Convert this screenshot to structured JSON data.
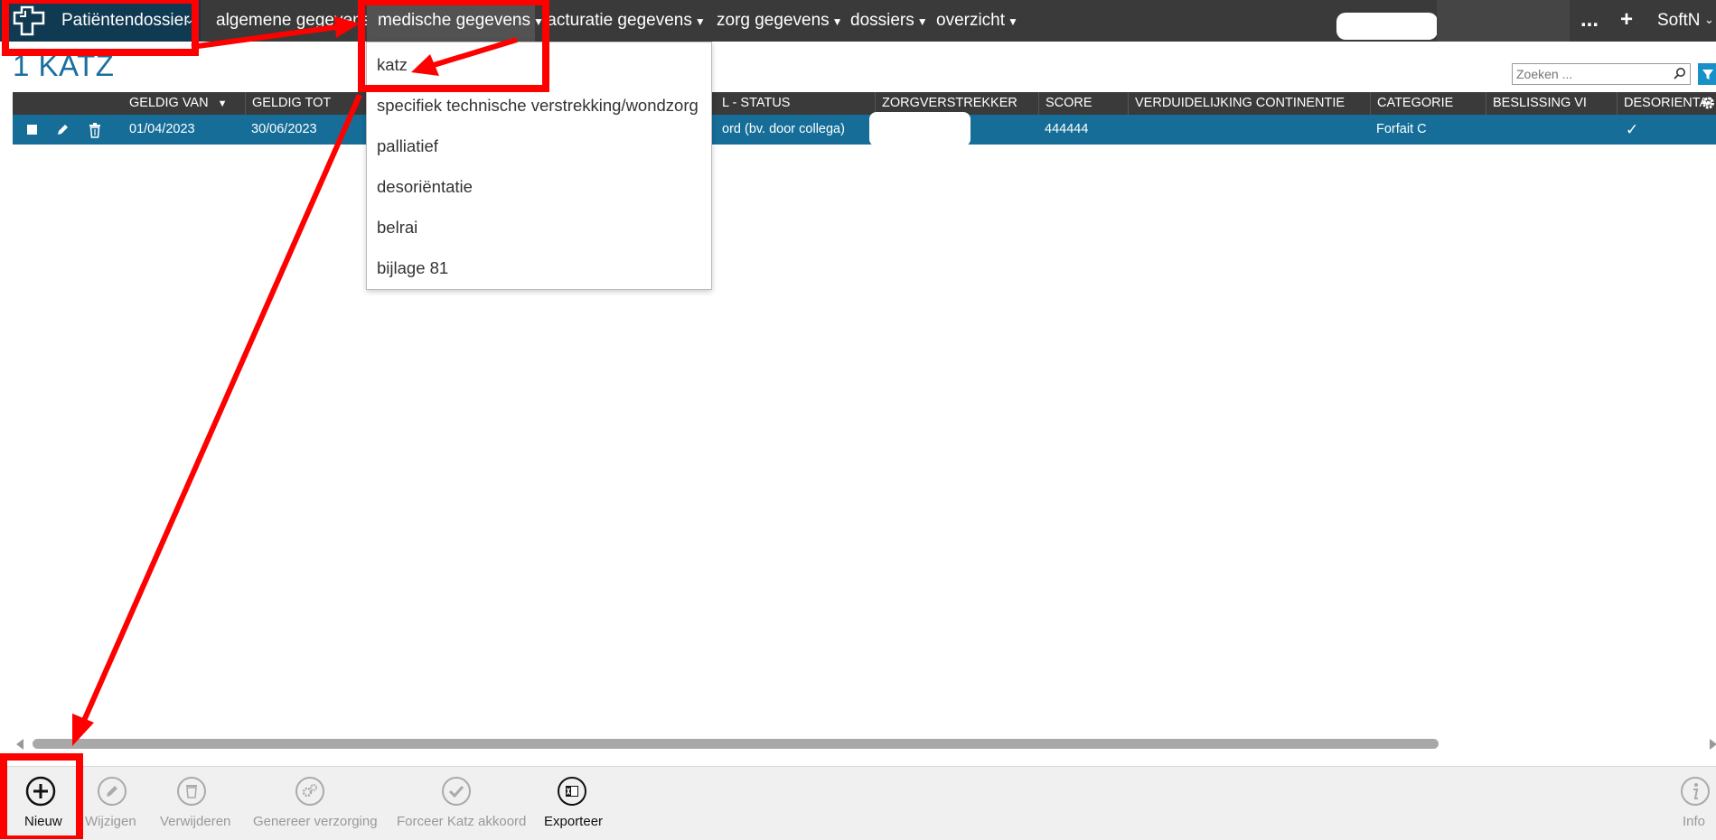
{
  "nav": {
    "brand": "Patiëntendossier",
    "items": [
      {
        "label": "algemene gegevens"
      },
      {
        "label": "medische gegevens"
      },
      {
        "label": "facturatie gegevens"
      },
      {
        "label": "zorg gegevens"
      },
      {
        "label": "dossiers"
      },
      {
        "label": "overzicht"
      }
    ],
    "more": "...",
    "add": "+",
    "user": "SoftN"
  },
  "page": {
    "title": "1 KATZ"
  },
  "search": {
    "placeholder": "Zoeken ..."
  },
  "grid": {
    "columns": [
      "GELDIG VAN",
      "GELDIG TOT",
      "",
      "",
      "L - STATUS",
      "ZORGVERSTREKKER",
      "SCORE",
      "VERDUIDELIJKING CONTINENTIE",
      "CATEGORIE",
      "BESLISSING VI",
      "DESORIENTATIE"
    ],
    "rows": [
      {
        "geldig_van": "01/04/2023",
        "geldig_tot": "30/06/2023",
        "status": "ord (bv. door collega)",
        "zorgverstrekker": "",
        "score": "444444",
        "verduidelijking": "",
        "categorie": "Forfait C",
        "beslissing": "",
        "desorientatie": "✓"
      }
    ]
  },
  "dropdown": {
    "items": [
      "katz",
      "specifiek technische verstrekking/wondzorg",
      "palliatief",
      "desoriëntatie",
      "belrai",
      "bijlage 81"
    ]
  },
  "toolbar": {
    "buttons": [
      {
        "label": "Nieuw",
        "icon": "plus-circle-icon"
      },
      {
        "label": "Wijzigen",
        "icon": "pencil-icon"
      },
      {
        "label": "Verwijderen",
        "icon": "trash-icon"
      },
      {
        "label": "Genereer verzorging",
        "icon": "gears-icon"
      },
      {
        "label": "Forceer Katz akkoord",
        "icon": "check-icon"
      },
      {
        "label": "Exporteer",
        "icon": "excel-icon"
      },
      {
        "label": "Info",
        "icon": "info-icon"
      }
    ]
  },
  "colors": {
    "nav_bg": "#3a3a3a",
    "brand_bg": "#0f3a52",
    "row_selected": "#166e98",
    "title": "#1a6fa0",
    "annotation": "#ff0000"
  }
}
